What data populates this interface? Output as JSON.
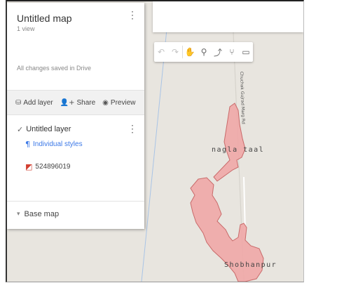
{
  "panel": {
    "title": "Untitled map",
    "views": "1 view",
    "save_status": "All changes saved in Drive",
    "menu_glyph": "⋮",
    "actions": [
      {
        "icon": "add-layer-icon",
        "glyph": "⛁",
        "label": "Add layer"
      },
      {
        "icon": "share-icon",
        "glyph": "👤+",
        "label": "Share"
      },
      {
        "icon": "preview-icon",
        "glyph": "◉",
        "label": "Preview"
      }
    ],
    "layer": {
      "checkbox_glyph": "✓",
      "title": "Untitled layer",
      "styles_glyph": "¶",
      "styles_label": "Individual styles",
      "feature_glyph": "◩",
      "feature_label": "524896019"
    },
    "basemap_glyph": "▾",
    "basemap_label": "Base map"
  },
  "toolbar": {
    "tools": [
      {
        "name": "undo-icon",
        "glyph": "↶",
        "enabled": false
      },
      {
        "name": "redo-icon",
        "glyph": "↷",
        "enabled": false
      },
      {
        "name": "hand-icon",
        "glyph": "✋",
        "enabled": true
      },
      {
        "name": "marker-icon",
        "glyph": "⚲",
        "enabled": true
      },
      {
        "name": "draw-line-icon",
        "glyph": "⤴",
        "enabled": true
      },
      {
        "name": "directions-icon",
        "glyph": "⑂",
        "enabled": true
      },
      {
        "name": "ruler-icon",
        "glyph": "▭",
        "enabled": true
      }
    ]
  },
  "map": {
    "place_labels": [
      "nagla taal",
      "Shobhanpur"
    ],
    "road_label": "Chuchak Gujrad Marg Rd"
  },
  "colors": {
    "polygon_fill": "#f0a7a7",
    "polygon_stroke": "#c96a6a",
    "map_bg": "#e8e5df",
    "accent": "#3b78e7"
  }
}
